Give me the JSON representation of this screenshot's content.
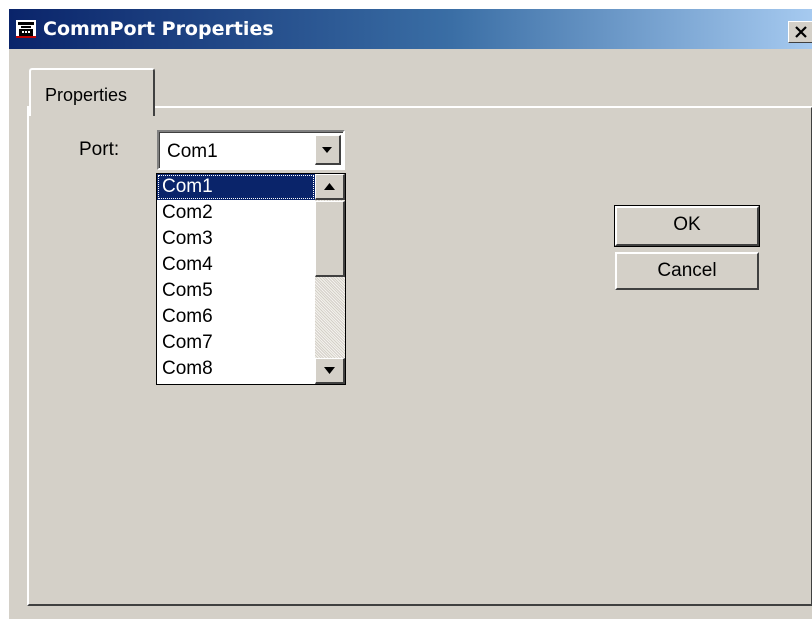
{
  "window": {
    "title": "CommPort Properties",
    "icon": "telephone-icon",
    "close_icon": "close-icon"
  },
  "tabs": [
    {
      "label": "Properties",
      "active": true
    }
  ],
  "form": {
    "port_label": "Port:",
    "port_value": "Com1",
    "dropdown_open": true,
    "options": [
      "Com1",
      "Com2",
      "Com3",
      "Com4",
      "Com5",
      "Com6",
      "Com7",
      "Com8"
    ],
    "selected_option": "Com1"
  },
  "buttons": {
    "ok_label": "OK",
    "cancel_label": "Cancel"
  },
  "colors": {
    "titlebar_start": "#0a246a",
    "titlebar_end": "#a6caf0",
    "face": "#d4d0c8",
    "selection": "#0a246a"
  }
}
